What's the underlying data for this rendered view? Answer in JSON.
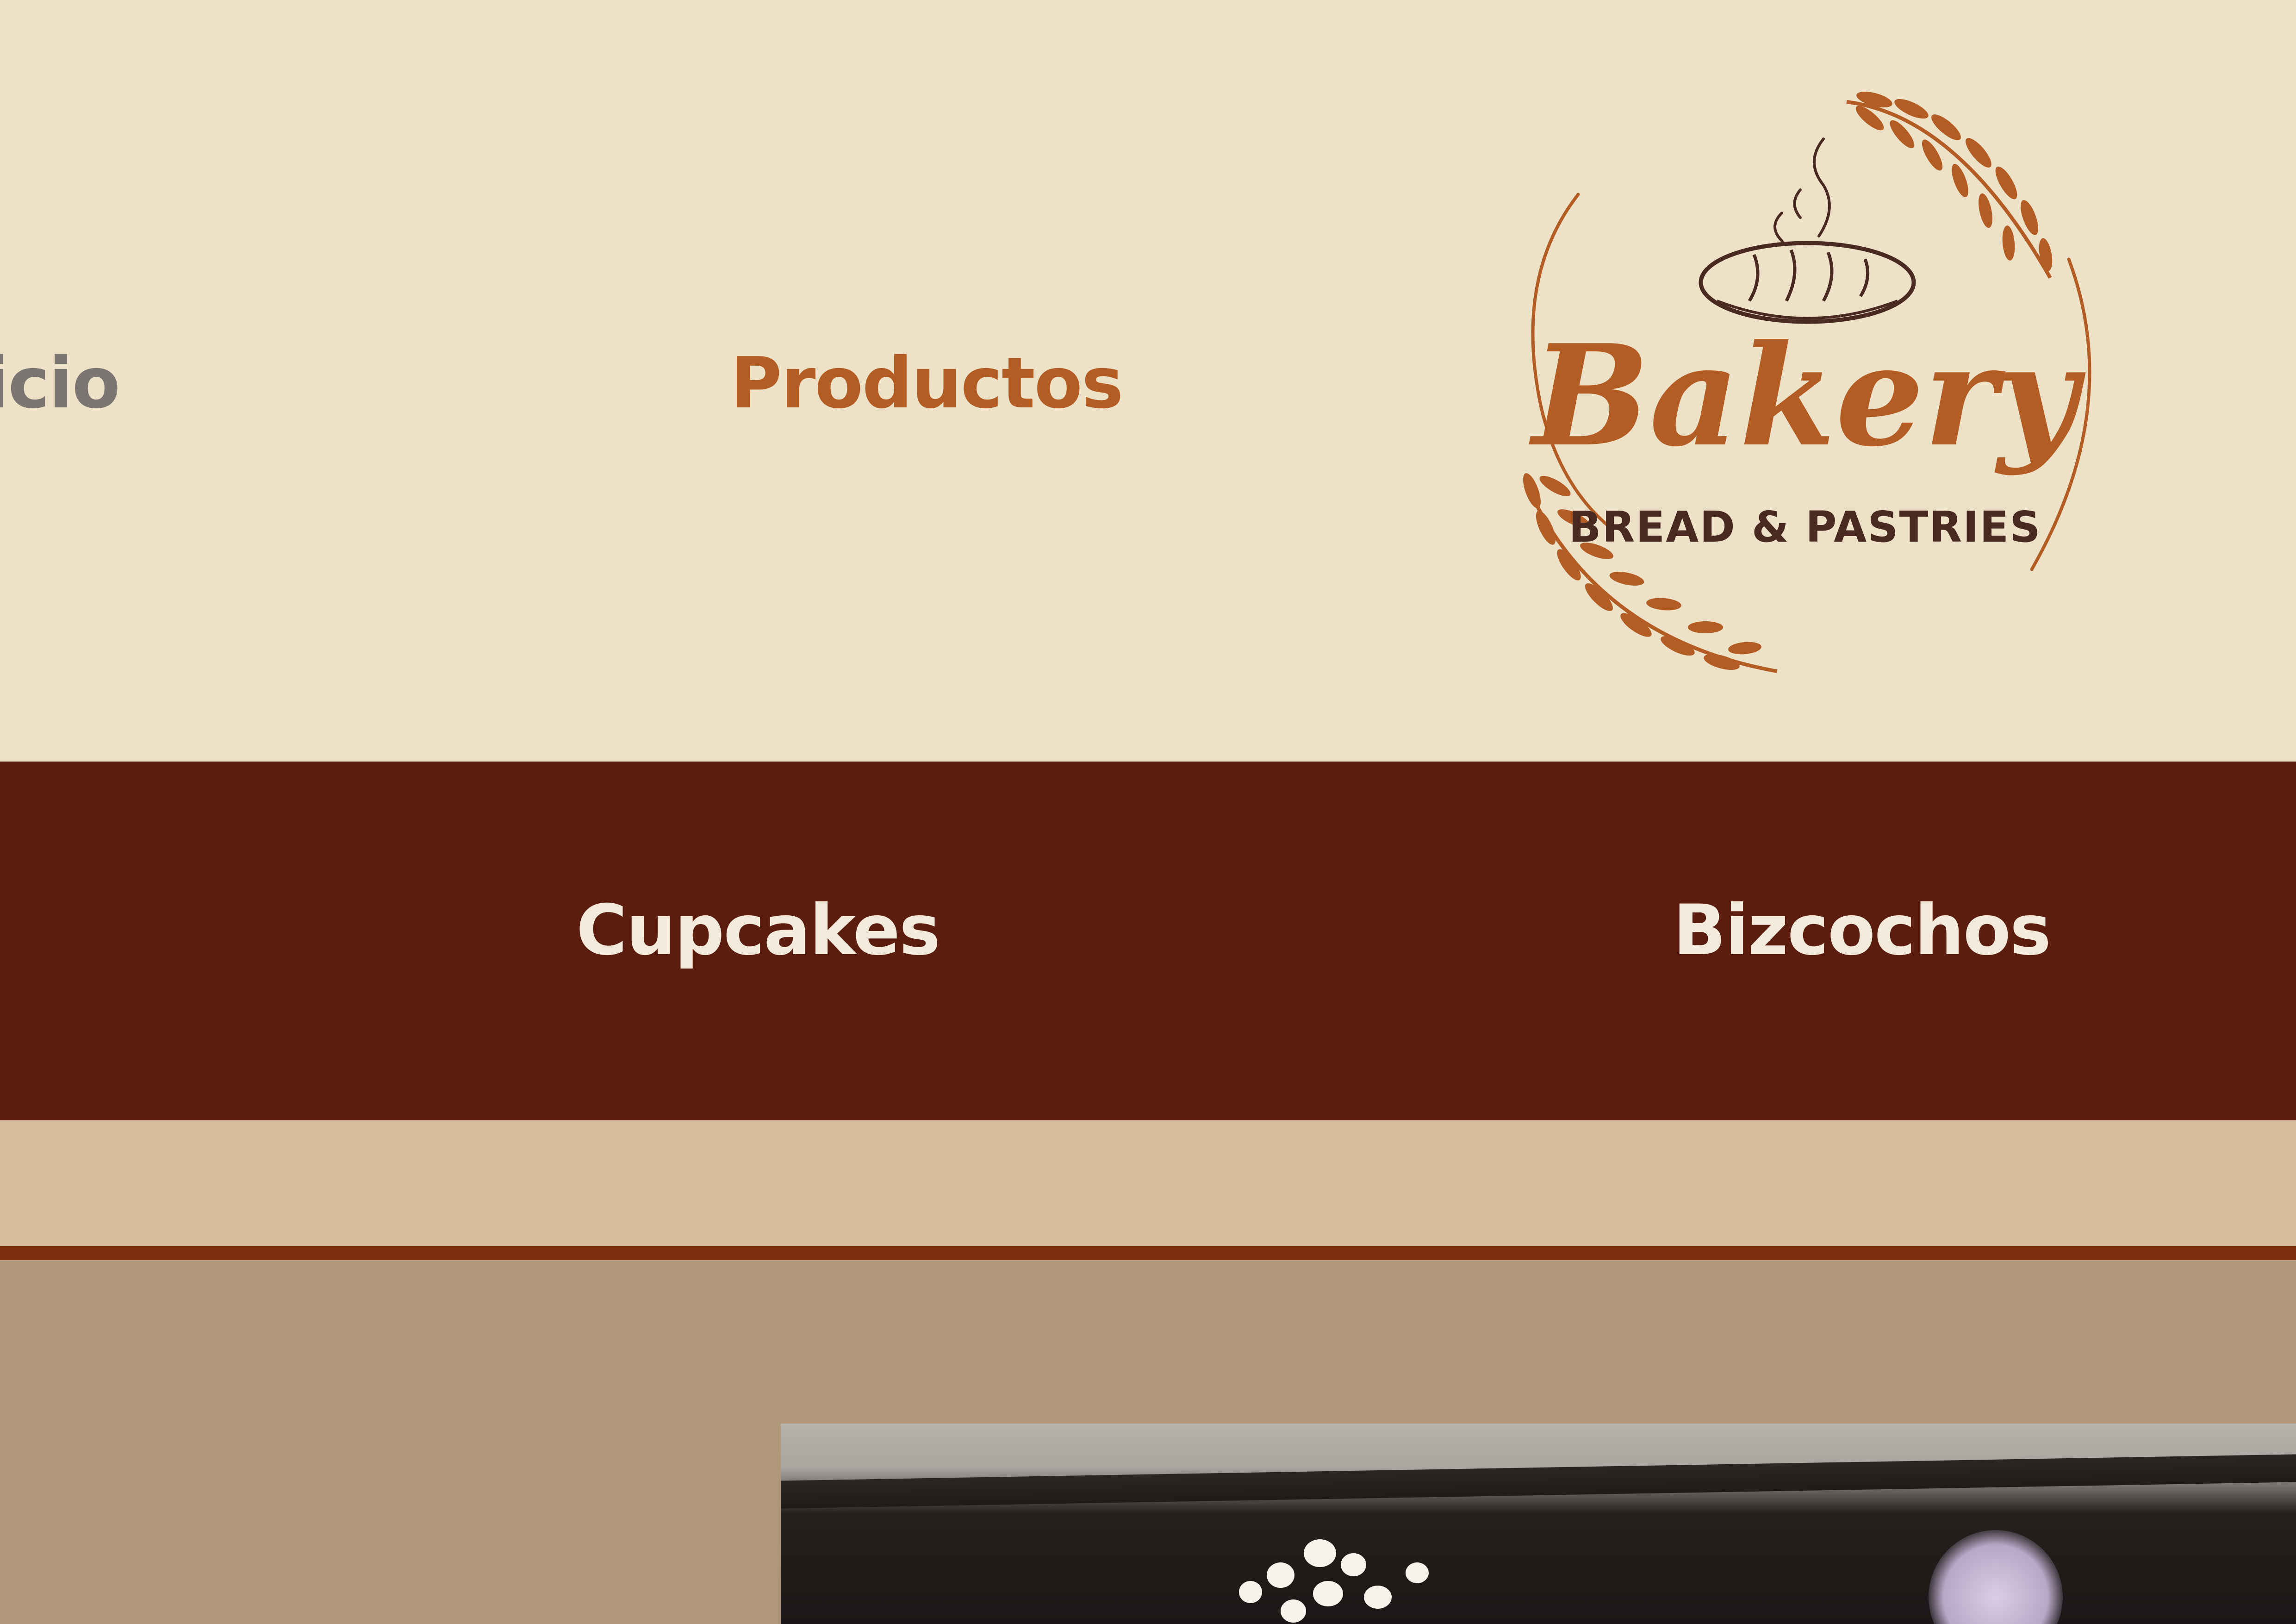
{
  "header": {
    "nav": {
      "inicio": "Inicio",
      "productos": "Productos"
    },
    "logo": {
      "title": "Bakery",
      "subtitle": "BREAD & PASTRIES",
      "icon": "bread-loaf-with-wheat-wreath"
    }
  },
  "categories": {
    "cupcakes": "Cupcakes",
    "bizcochos": "Bizcochos"
  },
  "colors": {
    "header_bg": "#ede2c8",
    "nav_inactive": "#7b7672",
    "nav_active": "#b35d24",
    "category_bar_bg": "#5b1d0e",
    "category_text": "#f4eadc",
    "strip_light": "#d5bc9c",
    "strip_line": "#7a2e0c",
    "content_bg": "#b09779",
    "logo_accent": "#b35d24",
    "logo_dark": "#4a2a20"
  }
}
